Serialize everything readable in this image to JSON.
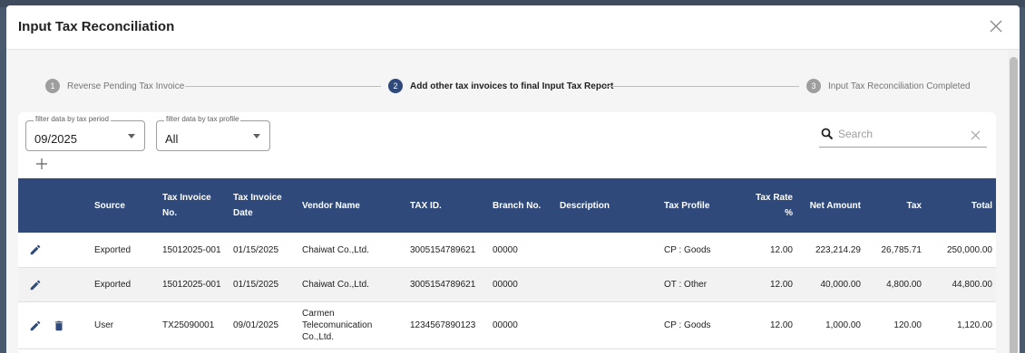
{
  "dialog": {
    "title": "Input Tax Reconciliation",
    "close_icon": "close-icon"
  },
  "stepper": [
    {
      "num": "1",
      "label": "Reverse Pending Tax Invoice",
      "active": false
    },
    {
      "num": "2",
      "label": "Add other tax invoices to final Input Tax Report",
      "active": true
    },
    {
      "num": "3",
      "label": "Input Tax Reconciliation Completed",
      "active": false
    }
  ],
  "filters": {
    "period": {
      "label": "filter data by tax period",
      "value": "09/2025"
    },
    "profile": {
      "label": "filter data by tax profile",
      "value": "All"
    }
  },
  "search": {
    "placeholder": "Search",
    "icon": "search-icon",
    "clear_icon": "clear-icon"
  },
  "add_icon": "plus-icon",
  "table": {
    "headers": {
      "source": "Source",
      "tax_invoice_no": "Tax Invoice No.",
      "tax_invoice_date": "Tax Invoice Date",
      "vendor_name": "Vendor Name",
      "tax_id": "TAX ID.",
      "branch_no": "Branch No.",
      "description": "Description",
      "tax_profile": "Tax Profile",
      "tax_rate": "Tax Rate %",
      "net_amount": "Net Amount",
      "tax": "Tax",
      "total": "Total"
    },
    "rows": [
      {
        "source": "Exported",
        "tax_invoice_no": "15012025-001",
        "tax_invoice_date": "01/15/2025",
        "vendor_name": "Chaiwat Co.,Ltd.",
        "tax_id": "3005154789621",
        "branch_no": "00000",
        "description": "",
        "tax_profile": "CP : Goods",
        "tax_rate": "12.00",
        "net_amount": "223,214.29",
        "tax": "26,785.71",
        "total": "250,000.00"
      },
      {
        "source": "Exported",
        "tax_invoice_no": "15012025-001",
        "tax_invoice_date": "01/15/2025",
        "vendor_name": "Chaiwat Co.,Ltd.",
        "tax_id": "3005154789621",
        "branch_no": "00000",
        "description": "",
        "tax_profile": "OT : Other",
        "tax_rate": "12.00",
        "net_amount": "40,000.00",
        "tax": "4,800.00",
        "total": "44,800.00"
      },
      {
        "source": "User",
        "tax_invoice_no": "TX25090001",
        "tax_invoice_date": "09/01/2025",
        "vendor_name": "Carmen Telecomunication Co.,Ltd.",
        "tax_id": "1234567890123",
        "branch_no": "00000",
        "description": "",
        "tax_profile": "CP : Goods",
        "tax_rate": "12.00",
        "net_amount": "1,000.00",
        "tax": "120.00",
        "total": "1,120.00"
      }
    ]
  },
  "colors": {
    "header_bg": "#2f4a7a",
    "active_step": "#2f4a7a",
    "inactive_step": "#9e9e9e"
  }
}
